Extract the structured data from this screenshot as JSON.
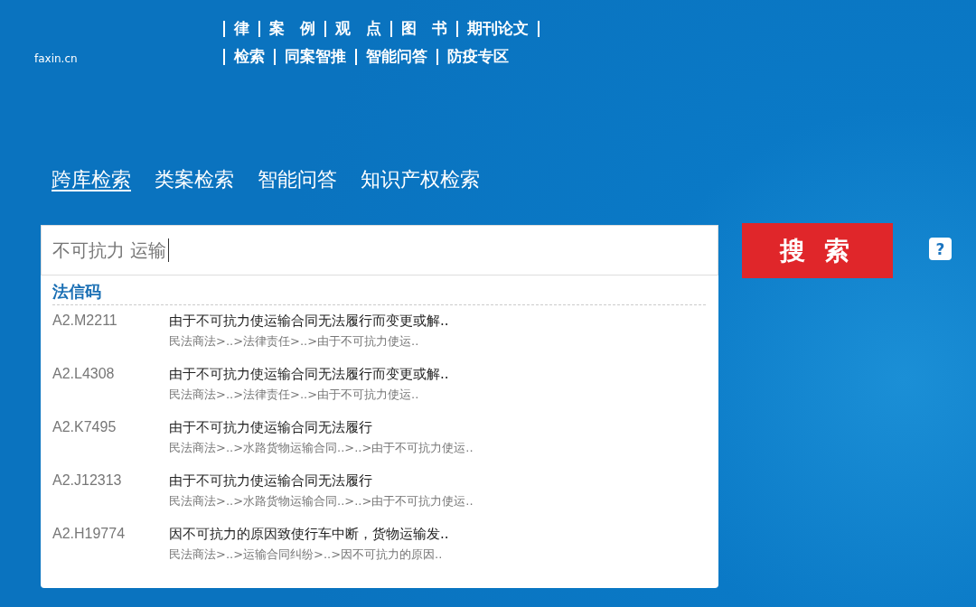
{
  "logo": {
    "text": "faxin.cn"
  },
  "top_nav": {
    "row_1": [
      "律",
      "案　例",
      "观　点",
      "图　书",
      "期刊论文"
    ],
    "row_2": [
      "检索",
      "同案智推",
      "智能问答",
      "防疫专区"
    ]
  },
  "search_tabs": [
    {
      "label": "跨库检索",
      "selected": true
    },
    {
      "label": "类案检索",
      "selected": false
    },
    {
      "label": "智能问答",
      "selected": false
    },
    {
      "label": "知识产权检索",
      "selected": false
    }
  ],
  "search": {
    "value": "不可抗力 运输",
    "button": "搜 索",
    "help": "?"
  },
  "suggestions": {
    "heading": "法信码",
    "items": [
      {
        "code": "A2.M2211",
        "title": "由于不可抗力使运输合同无法履行而变更或解..",
        "path": "民法商法>..>法律责任>..>由于不可抗力使运.."
      },
      {
        "code": "A2.L4308",
        "title": "由于不可抗力使运输合同无法履行而变更或解..",
        "path": "民法商法>..>法律责任>..>由于不可抗力使运.."
      },
      {
        "code": "A2.K7495",
        "title": "由于不可抗力使运输合同无法履行",
        "path": "民法商法>..>水路货物运输合同..>..>由于不可抗力使运.."
      },
      {
        "code": "A2.J12313",
        "title": "由于不可抗力使运输合同无法履行",
        "path": "民法商法>..>水路货物运输合同..>..>由于不可抗力使运.."
      },
      {
        "code": "A2.H19774",
        "title": "因不可抗力的原因致使行车中断，货物运输发..",
        "path": "民法商法>..>运输合同纠纷>..>因不可抗力的原因.."
      }
    ]
  }
}
